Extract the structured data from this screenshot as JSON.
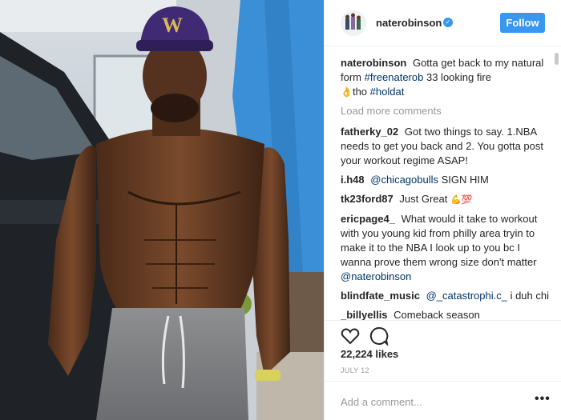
{
  "header": {
    "username": "naterobinson",
    "follow_label": "Follow",
    "verified_icon": "verified-badge-icon"
  },
  "caption": {
    "user": "naterobinson",
    "text_a": "Gotta get back to my natural form",
    "tag_1": "#freenaterob",
    "text_b": "33 looking fire",
    "emoji_1": "👌",
    "text_c": "tho",
    "tag_2": "#holdat"
  },
  "load_more": "Load more comments",
  "comments": [
    {
      "user": "fatherky_02",
      "text": "Got two things to say. 1.NBA needs to get you back and 2. You gotta post your workout regime ASAP!"
    },
    {
      "user": "i.h48",
      "mention": "@chicagobulls",
      "text": "SIGN HIM"
    },
    {
      "user": "tk23ford87",
      "text": "Just Great",
      "emoji": "💪💯"
    },
    {
      "user": "ericpage4_",
      "text": "What would it take to workout with you young kid from philly area tryin to make it to the NBA I look up to you bc I wanna prove them wrong size don't matter",
      "mention": "@naterobinson"
    },
    {
      "user": "blindfate_music",
      "mention": "@_catastrophi.c_",
      "text": "i duh chi"
    },
    {
      "user": "_billyellis",
      "text": "Comeback season"
    }
  ],
  "actions": {
    "like_icon": "heart-icon",
    "comment_icon": "comment-bubble-icon",
    "likes": "22,224 likes",
    "date": "JULY 12"
  },
  "add_comment": {
    "placeholder": "Add a comment...",
    "more_icon": "more-options-icon",
    "more_glyph": "•••"
  },
  "colors": {
    "accent": "#3897f0",
    "text": "#262626",
    "muted": "#999999",
    "hashtag": "#003569"
  }
}
